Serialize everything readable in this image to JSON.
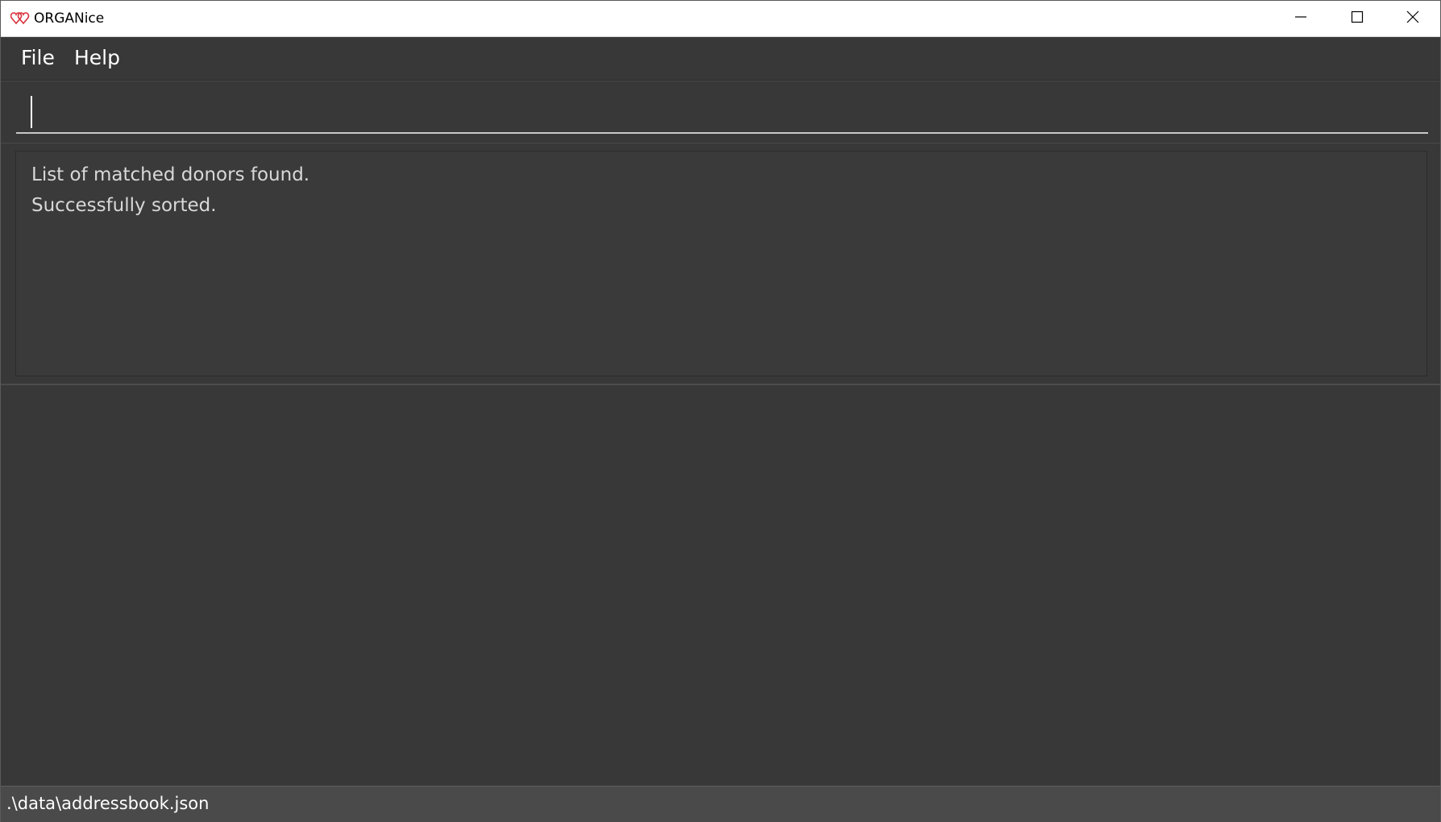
{
  "window": {
    "title": "ORGANice",
    "icon": "double-heart-icon",
    "controls": {
      "minimize": "minimize-icon",
      "maximize": "maximize-icon",
      "close": "close-icon"
    }
  },
  "menubar": {
    "items": [
      {
        "label": "File"
      },
      {
        "label": "Help"
      }
    ]
  },
  "command": {
    "value": "",
    "placeholder": ""
  },
  "result": {
    "lines": [
      "List of matched donors found.",
      "Successfully sorted."
    ]
  },
  "status": {
    "file_path": ".\\data\\addressbook.json"
  },
  "colors": {
    "background": "#383838",
    "titlebar": "#ffffff",
    "statusbar": "#4a4a4a",
    "text": "#ffffff",
    "result_text": "#d8d8d8",
    "icon_accent": "#d9303a"
  }
}
